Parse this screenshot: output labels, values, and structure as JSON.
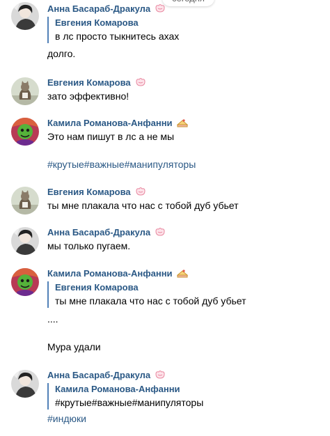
{
  "date_separator": "сегодня",
  "messages": [
    {
      "author": "Анна Басараб-Дракула",
      "badge": "sakura-icon",
      "quote": {
        "author": "Евгения Комарова",
        "text": "в лс просто тыкнитесь ахах"
      },
      "text": "долго."
    },
    {
      "author": "Евгения Комарова",
      "badge": "sakura-icon",
      "text": "зато эффективно!"
    },
    {
      "author": "Камила Романова-Анфанни",
      "badge": "cake-icon",
      "text": "Это нам пишут в лс а не мы",
      "hashtags": "#крутые#важные#манипуляторы"
    },
    {
      "author": "Евгения Комарова",
      "badge": "sakura-icon",
      "text": "ты мне плакала что нас с тобой дуб убьет"
    },
    {
      "author": "Анна Басараб-Дракула",
      "badge": "sakura-icon",
      "text": "мы только пугаем."
    },
    {
      "author": "Камила Романова-Анфанни",
      "badge": "cake-icon",
      "quote": {
        "author": "Евгения Комарова",
        "text": "ты мне плакала что нас с тобой дуб убьет"
      },
      "text": "....",
      "text2": "Мура удали"
    },
    {
      "author": "Анна Басараб-Дракула",
      "badge": "sakura-icon",
      "quote": {
        "author": "Камила Романова-Анфанни",
        "text": "#крутые#важные#манипуляторы"
      },
      "hashtags": "#индюки"
    }
  ],
  "colors": {
    "link": "#2a5885",
    "quote_border": "#5181b8",
    "text": "#000000",
    "date_chip_text": "#656565"
  }
}
